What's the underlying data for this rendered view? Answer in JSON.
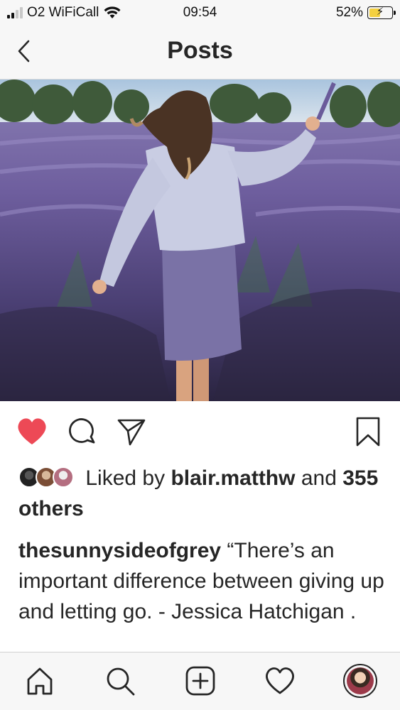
{
  "status_bar": {
    "carrier": "O2 WiFiCall",
    "time": "09:54",
    "battery": "52%",
    "battery_level": 0.52,
    "signal_bars": 2
  },
  "header": {
    "title": "Posts",
    "back_icon": "chevron-left-icon"
  },
  "post": {
    "image_subject": "woman in sweater walking through lavender field",
    "liked": true,
    "like_color": "#ed4956",
    "likes": {
      "prefix": "Liked by",
      "user": "blair.matthw",
      "connector": "and",
      "others": "355 others"
    },
    "caption": {
      "username": "thesunnysideofgrey",
      "text": "“There’s an important difference between giving up and letting go. - Jessica Hatchigan ."
    }
  },
  "tabbar": {
    "items": [
      {
        "name": "home",
        "icon": "home-icon"
      },
      {
        "name": "search",
        "icon": "search-icon"
      },
      {
        "name": "new-post",
        "icon": "add-post-icon"
      },
      {
        "name": "activity",
        "icon": "heart-outline-icon"
      },
      {
        "name": "profile",
        "icon": "avatar"
      }
    ]
  }
}
